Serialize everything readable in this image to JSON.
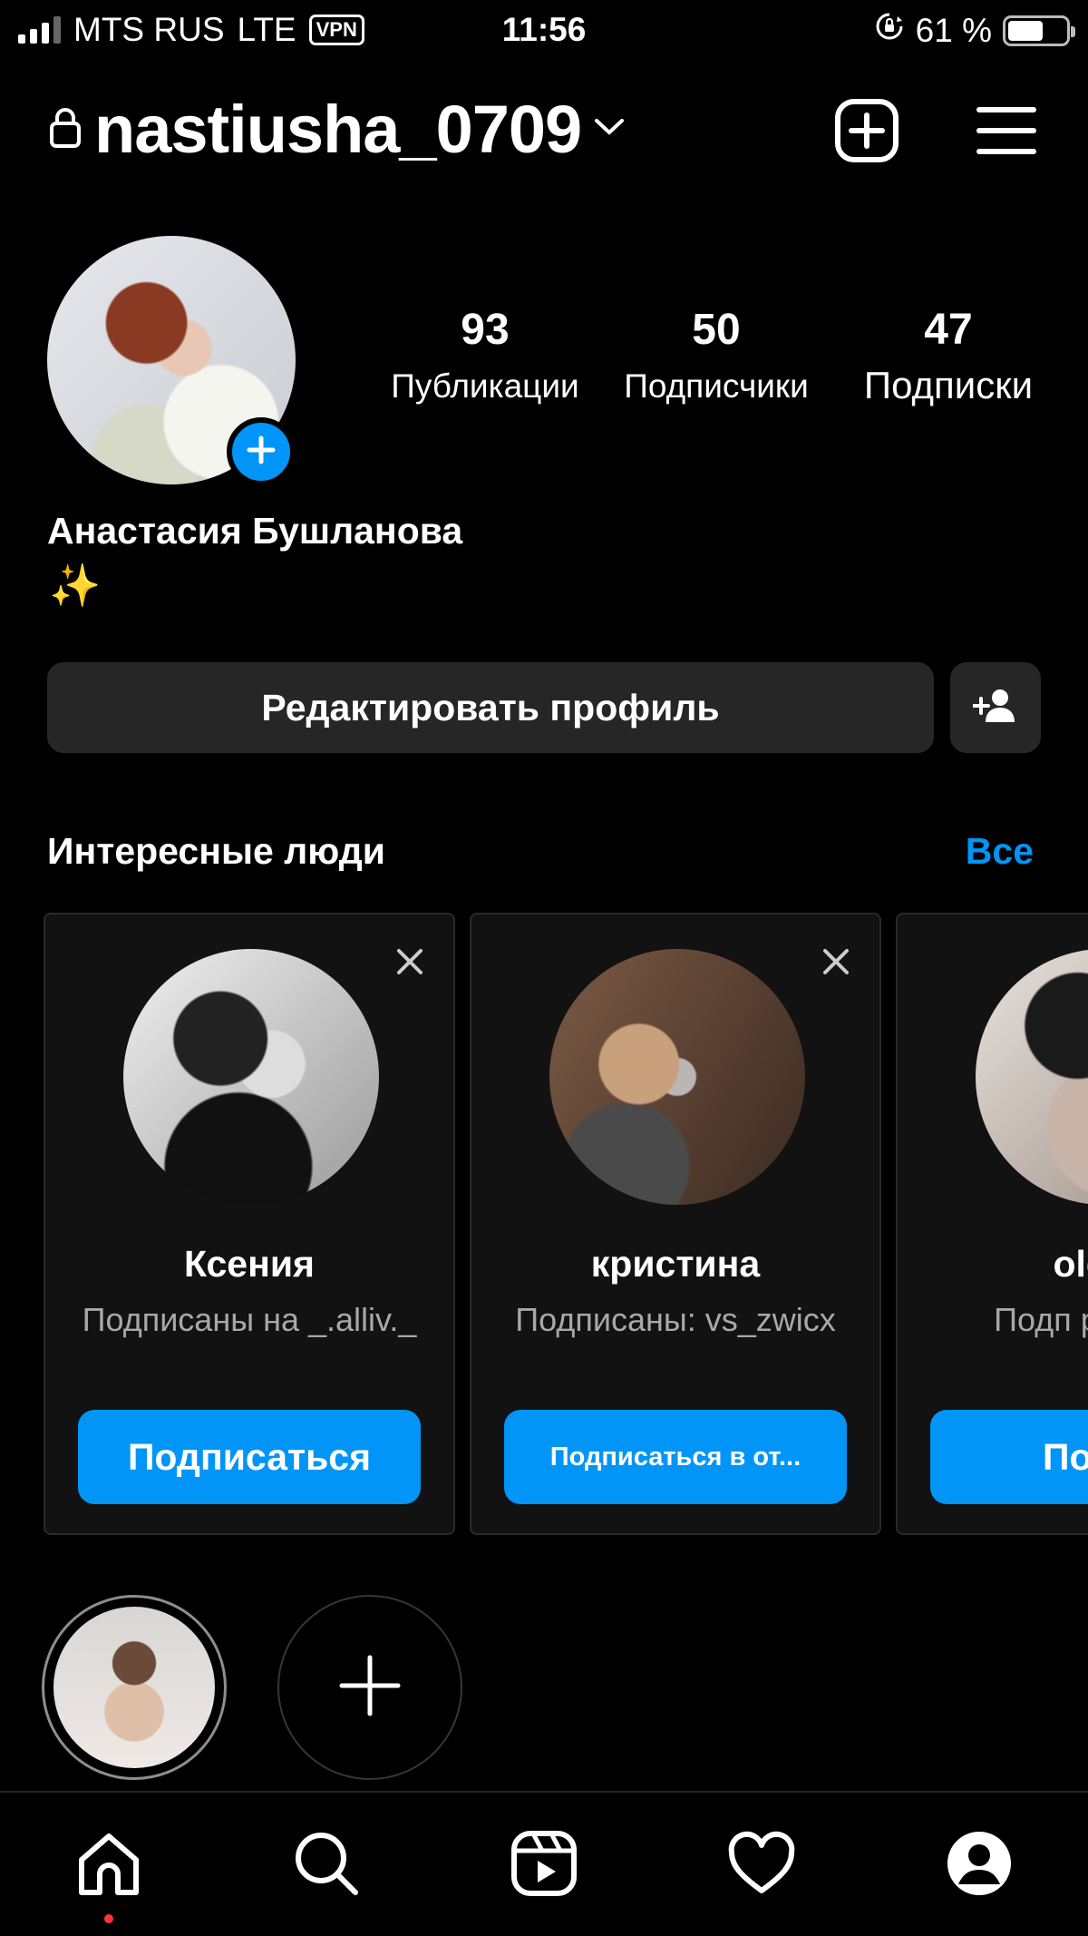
{
  "status_bar": {
    "carrier": "MTS RUS",
    "network": "LTE",
    "vpn": "VPN",
    "time": "11:56",
    "battery": "61 %",
    "battery_level": 0.61
  },
  "header": {
    "username": "nastiusha_0709"
  },
  "profile": {
    "stats": [
      {
        "value": "93",
        "label": "Публикации"
      },
      {
        "value": "50",
        "label": "Подписчики"
      },
      {
        "value": "47",
        "label": "Подписки"
      }
    ],
    "full_name": "Анастасия Бушланова",
    "bio": "✨",
    "edit_button": "Редактировать профиль"
  },
  "suggestions": {
    "title": "Интересные люди",
    "see_all": "Все",
    "cards": [
      {
        "name": "Ксения",
        "subtitle": "Подписаны на _.alliv._",
        "button": "Подписаться"
      },
      {
        "name": "кристина",
        "subtitle": "Подписаны: vs_zwicx",
        "button": "Подписаться в от..."
      },
      {
        "name": "olesh",
        "subtitle": "Подп pivo.s.ch",
        "button": "Подпи"
      }
    ]
  },
  "colors": {
    "accent": "#0095f6",
    "background": "#000000",
    "button_bg": "#262626",
    "card_bg": "#121212",
    "notification_dot": "#ff3040"
  },
  "bottom_nav": [
    "home-icon",
    "search-icon",
    "reels-icon",
    "heart-icon",
    "profile-icon"
  ]
}
